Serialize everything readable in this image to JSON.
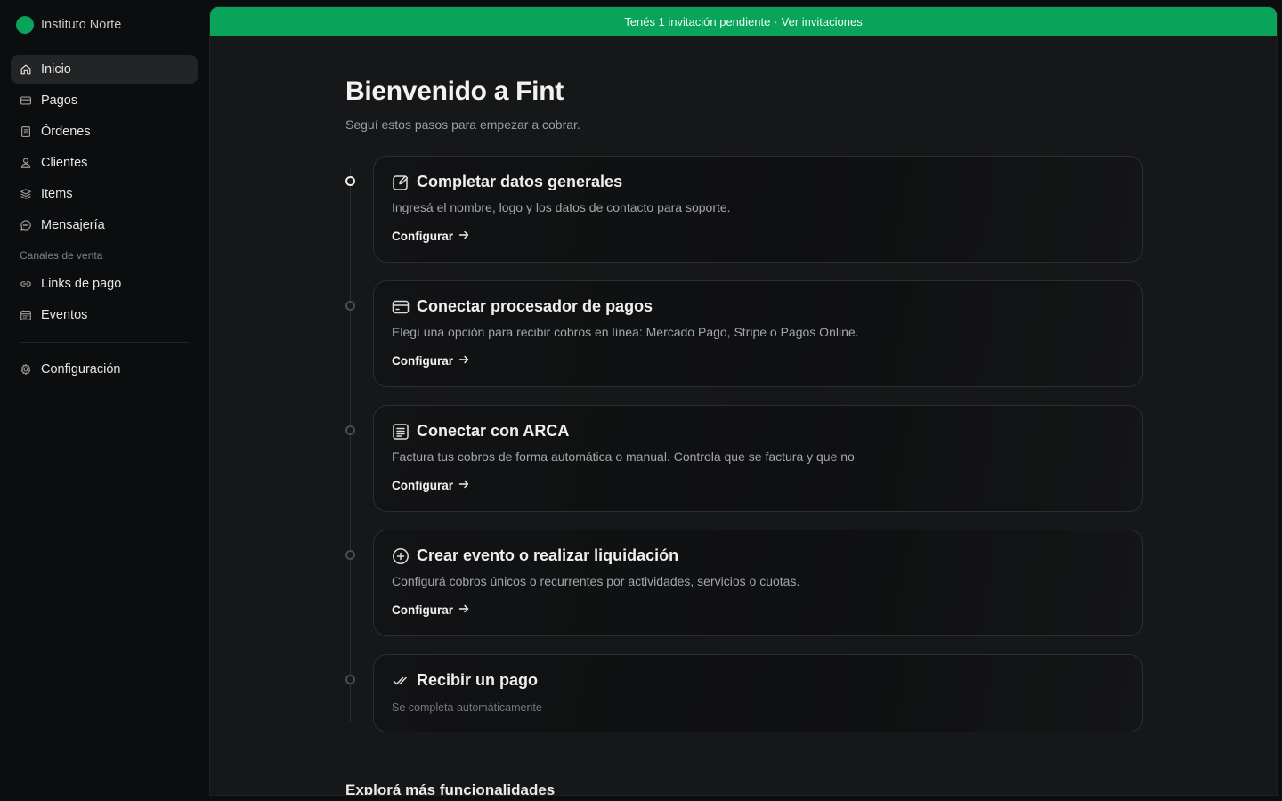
{
  "org": {
    "name": "Instituto Norte",
    "color": "#0aa35a"
  },
  "sidebar": {
    "items": [
      {
        "label": "Inicio",
        "icon": "home-icon",
        "active": true
      },
      {
        "label": "Pagos",
        "icon": "card-icon"
      },
      {
        "label": "Órdenes",
        "icon": "document-icon"
      },
      {
        "label": "Clientes",
        "icon": "user-icon"
      },
      {
        "label": "Items",
        "icon": "layers-icon"
      },
      {
        "label": "Mensajería",
        "icon": "chat-icon"
      }
    ],
    "section_label": "Canales de venta",
    "channel_items": [
      {
        "label": "Links de pago",
        "icon": "link-icon"
      },
      {
        "label": "Eventos",
        "icon": "calendar-icon"
      }
    ],
    "settings_label": "Configuración"
  },
  "banner": {
    "text": "Tenés 1 invitación pendiente",
    "separator": "·",
    "link": "Ver invitaciones",
    "color": "#0aa35a"
  },
  "page": {
    "title": "Bienvenido a Fint",
    "subtitle": "Seguí estos pasos para empezar a cobrar."
  },
  "steps": [
    {
      "title": "Completar datos generales",
      "icon": "edit-icon",
      "description": "Ingresá el nombre, logo y los datos de contacto para soporte.",
      "link": "Configurar",
      "current": true
    },
    {
      "title": "Conectar procesador de pagos",
      "icon": "card-icon",
      "description": "Elegí una opción para recibir cobros en línea: Mercado Pago, Stripe o Pagos Online.",
      "link": "Configurar"
    },
    {
      "title": "Conectar con ARCA",
      "icon": "receipt-icon",
      "description": "Factura tus cobros de forma automática o manual. Controla que se factura y que no",
      "link": "Configurar"
    },
    {
      "title": "Crear evento o realizar liquidación",
      "icon": "plus-circle-icon",
      "description": "Configurá cobros únicos o recurrentes por actividades, servicios o cuotas.",
      "link": "Configurar"
    },
    {
      "title": "Recibir un pago",
      "icon": "double-check-icon",
      "description": "Se completa automáticamente"
    }
  ],
  "explore_title": "Explorá más funcionalidades"
}
